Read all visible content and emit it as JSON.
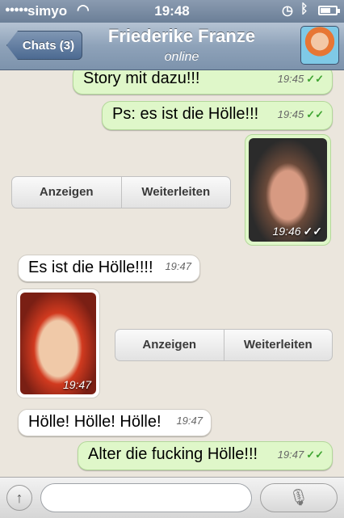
{
  "status": {
    "carrier": "simyo",
    "time": "19:48"
  },
  "nav": {
    "back_label": "Chats (3)",
    "title": "Friederike Franze",
    "subtitle": "online"
  },
  "messages": [
    {
      "text": "Story mit dazu!!!",
      "time": "19:45",
      "ticks": "✓✓"
    },
    {
      "text": "Ps: es ist die Hölle!!!",
      "time": "19:45",
      "ticks": "✓✓"
    },
    {
      "image_time": "19:46",
      "ticks": "✓✓"
    },
    {
      "show_label": "Anzeigen",
      "forward_label": "Weiterleiten"
    },
    {
      "text": "Es ist die Hölle!!!!",
      "time": "19:47"
    },
    {
      "image_time": "19:47"
    },
    {
      "show_label": "Anzeigen",
      "forward_label": "Weiterleiten"
    },
    {
      "text": "Hölle! Hölle! Hölle!",
      "time": "19:47"
    },
    {
      "text": "Alter die fucking Hölle!!!",
      "time": "19:47",
      "ticks": "✓✓"
    }
  ],
  "input": {
    "placeholder": ""
  },
  "icons": {
    "attach": "upload-arrow-icon",
    "mic": "microphone-icon"
  }
}
